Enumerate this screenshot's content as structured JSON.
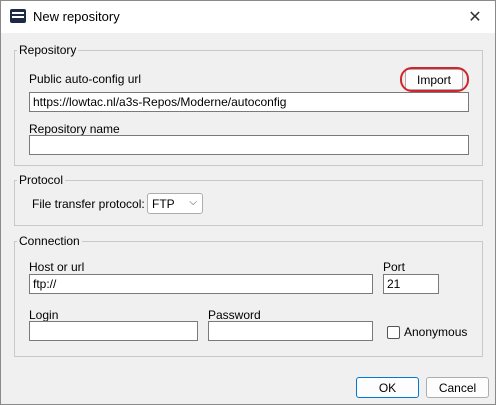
{
  "window": {
    "title": "New repository",
    "close_glyph": "✕",
    "app_icon": "app-logo-icon"
  },
  "repository": {
    "legend": "Repository",
    "url_label": "Public auto-config url",
    "import_label": "Import",
    "url_value": "https://lowtac.nl/a3s-Repos/Moderne/autoconfig",
    "name_label": "Repository name",
    "name_value": ""
  },
  "protocol": {
    "legend": "Protocol",
    "label": "File transfer protocol:",
    "selected": "FTP",
    "chevron_icon": "chevron-down-icon"
  },
  "connection": {
    "legend": "Connection",
    "host_label": "Host or url",
    "host_value": "ftp://",
    "port_label": "Port",
    "port_value": "21",
    "login_label": "Login",
    "login_value": "",
    "password_label": "Password",
    "password_value": "",
    "anonymous_label": "Anonymous",
    "anonymous_checked": false
  },
  "footer": {
    "ok_label": "OK",
    "cancel_label": "Cancel"
  },
  "colors": {
    "highlight_ring": "#d2252b",
    "default_button_border": "#0078d4"
  }
}
